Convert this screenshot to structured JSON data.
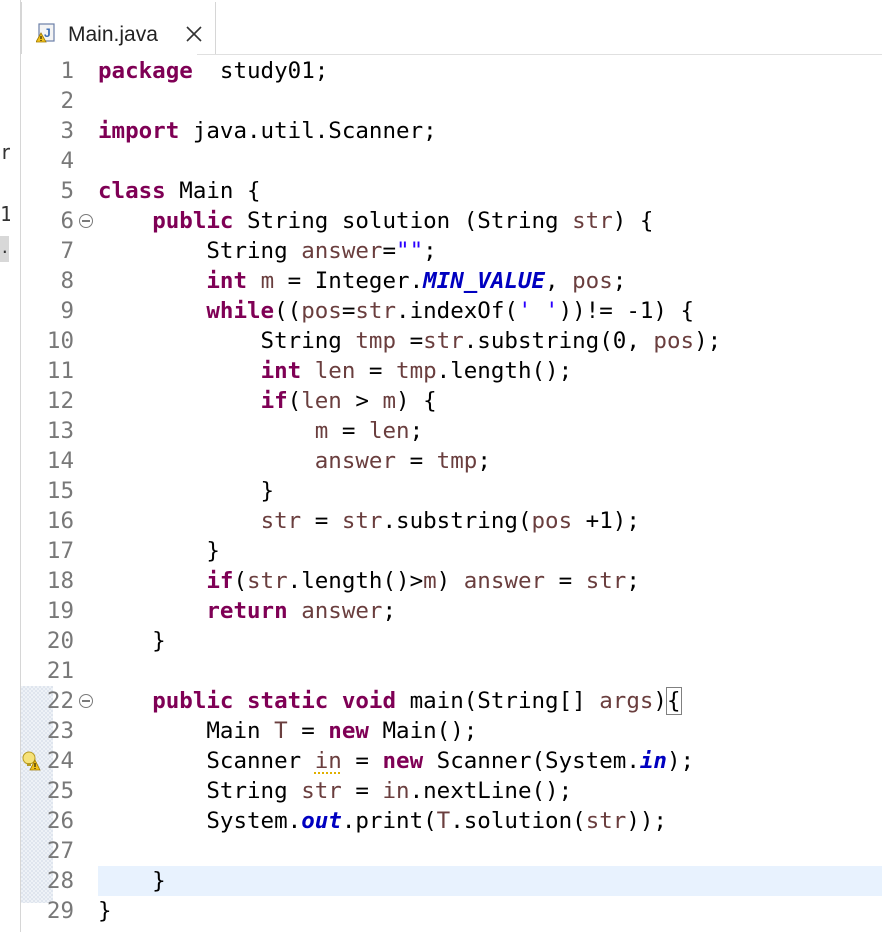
{
  "tab": {
    "title": "Main.java"
  },
  "stray_left": [
    "r",
    "1",
    "."
  ],
  "editor": {
    "lines": [
      {
        "n": "1",
        "segs": [
          [
            "kw",
            "package"
          ],
          [
            "",
            "  study01;"
          ]
        ]
      },
      {
        "n": "2",
        "segs": []
      },
      {
        "n": "3",
        "segs": [
          [
            "kw",
            "import"
          ],
          [
            "",
            " java.util.Scanner;"
          ]
        ]
      },
      {
        "n": "4",
        "segs": []
      },
      {
        "n": "5",
        "segs": [
          [
            "kw",
            "class"
          ],
          [
            "",
            " Main {"
          ]
        ]
      },
      {
        "n": "6",
        "segs": [
          [
            "",
            "    "
          ],
          [
            "kw",
            "public"
          ],
          [
            "",
            " String solution (String "
          ],
          [
            "var",
            "str"
          ],
          [
            "",
            ") {"
          ]
        ]
      },
      {
        "n": "7",
        "segs": [
          [
            "",
            "        String "
          ],
          [
            "var",
            "answer"
          ],
          [
            "",
            "="
          ],
          [
            "str",
            "\"\""
          ],
          [
            "",
            ";"
          ]
        ]
      },
      {
        "n": "8",
        "segs": [
          [
            "",
            "        "
          ],
          [
            "kw",
            "int"
          ],
          [
            "",
            "",
            " "
          ],
          [
            "var",
            "m"
          ],
          [
            "",
            " = Integer."
          ],
          [
            "const",
            "MIN_VALUE"
          ],
          [
            "",
            ", "
          ],
          [
            "var",
            "pos"
          ],
          [
            "",
            ";"
          ]
        ]
      },
      {
        "n": "9",
        "segs": [
          [
            "",
            "        "
          ],
          [
            "kw",
            "while"
          ],
          [
            "",
            "(("
          ],
          [
            "var",
            "pos"
          ],
          [
            "",
            "="
          ],
          [
            "var",
            "str"
          ],
          [
            "",
            ".indexOf("
          ],
          [
            "str",
            "' '"
          ],
          [
            "",
            "))!= -1) {"
          ]
        ]
      },
      {
        "n": "10",
        "segs": [
          [
            "",
            "            String "
          ],
          [
            "var",
            "tmp"
          ],
          [
            "",
            " ="
          ],
          [
            "var",
            "str"
          ],
          [
            "",
            ".substring(0, "
          ],
          [
            "var",
            "pos"
          ],
          [
            "",
            ");"
          ]
        ]
      },
      {
        "n": "11",
        "segs": [
          [
            "",
            "            "
          ],
          [
            "kw",
            "int"
          ],
          [
            "",
            " "
          ],
          [
            "var",
            "len"
          ],
          [
            "",
            " = "
          ],
          [
            "var",
            "tmp"
          ],
          [
            "",
            ".length();"
          ]
        ]
      },
      {
        "n": "12",
        "segs": [
          [
            "",
            "            "
          ],
          [
            "kw",
            "if"
          ],
          [
            "",
            "("
          ],
          [
            "var",
            "len"
          ],
          [
            "",
            " > "
          ],
          [
            "var",
            "m"
          ],
          [
            "",
            ") {"
          ]
        ]
      },
      {
        "n": "13",
        "segs": [
          [
            "",
            "                "
          ],
          [
            "var",
            "m"
          ],
          [
            "",
            " = "
          ],
          [
            "var",
            "len"
          ],
          [
            "",
            ";"
          ]
        ]
      },
      {
        "n": "14",
        "segs": [
          [
            "",
            "                "
          ],
          [
            "var",
            "answer"
          ],
          [
            "",
            " = "
          ],
          [
            "var",
            "tmp"
          ],
          [
            "",
            ";"
          ]
        ]
      },
      {
        "n": "15",
        "segs": [
          [
            "",
            "            }"
          ]
        ]
      },
      {
        "n": "16",
        "segs": [
          [
            "",
            "            "
          ],
          [
            "var",
            "str"
          ],
          [
            "",
            " = "
          ],
          [
            "var",
            "str"
          ],
          [
            "",
            ".substring("
          ],
          [
            "var",
            "pos"
          ],
          [
            "",
            " +1);"
          ]
        ]
      },
      {
        "n": "17",
        "segs": [
          [
            "",
            "        }"
          ]
        ]
      },
      {
        "n": "18",
        "segs": [
          [
            "",
            "        "
          ],
          [
            "kw",
            "if"
          ],
          [
            "",
            "("
          ],
          [
            "var",
            "str"
          ],
          [
            "",
            ".length()>"
          ],
          [
            "var",
            "m"
          ],
          [
            "",
            ") "
          ],
          [
            "var",
            "answer"
          ],
          [
            "",
            " = "
          ],
          [
            "var",
            "str"
          ],
          [
            "",
            ";"
          ]
        ]
      },
      {
        "n": "19",
        "segs": [
          [
            "",
            "        "
          ],
          [
            "kw",
            "return"
          ],
          [
            "",
            " "
          ],
          [
            "var",
            "answer"
          ],
          [
            "",
            ";"
          ]
        ]
      },
      {
        "n": "20",
        "segs": [
          [
            "",
            "    }"
          ]
        ]
      },
      {
        "n": "21",
        "segs": []
      },
      {
        "n": "22",
        "segs": [
          [
            "",
            "    "
          ],
          [
            "kw",
            "public"
          ],
          [
            "",
            " "
          ],
          [
            "kw",
            "static"
          ],
          [
            "",
            " "
          ],
          [
            "kw",
            "void"
          ],
          [
            "",
            " main(String[] "
          ],
          [
            "var",
            "args"
          ],
          [
            "",
            ")"
          ],
          [
            "box",
            "{"
          ]
        ]
      },
      {
        "n": "23",
        "segs": [
          [
            "",
            "        Main "
          ],
          [
            "var",
            "T"
          ],
          [
            "",
            " = "
          ],
          [
            "kw",
            "new"
          ],
          [
            "",
            " Main();"
          ]
        ]
      },
      {
        "n": "24",
        "segs": [
          [
            "",
            "        Scanner "
          ],
          [
            "warn",
            "in"
          ],
          [
            "",
            " = "
          ],
          [
            "kw",
            "new"
          ],
          [
            "",
            " Scanner(System."
          ],
          [
            "field",
            "in"
          ],
          [
            "",
            ");"
          ]
        ]
      },
      {
        "n": "25",
        "segs": [
          [
            "",
            "        String "
          ],
          [
            "var",
            "str"
          ],
          [
            "",
            " = "
          ],
          [
            "var",
            "in"
          ],
          [
            "",
            ".nextLine();"
          ]
        ]
      },
      {
        "n": "26",
        "segs": [
          [
            "",
            "        System."
          ],
          [
            "field",
            "out"
          ],
          [
            "",
            ".print("
          ],
          [
            "var",
            "T"
          ],
          [
            "",
            ".solution("
          ],
          [
            "var",
            "str"
          ],
          [
            "",
            "));"
          ]
        ]
      },
      {
        "n": "27",
        "segs": []
      },
      {
        "n": "28",
        "segs": [
          [
            "",
            "    }"
          ]
        ]
      },
      {
        "n": "29",
        "segs": [
          [
            "",
            "}"
          ]
        ]
      }
    ]
  },
  "colors": {
    "keyword": "#7f0055",
    "variable": "#6a3e3e",
    "string": "#2a00ff",
    "constant": "#0000c0",
    "current_line": "#e8f2fe"
  }
}
